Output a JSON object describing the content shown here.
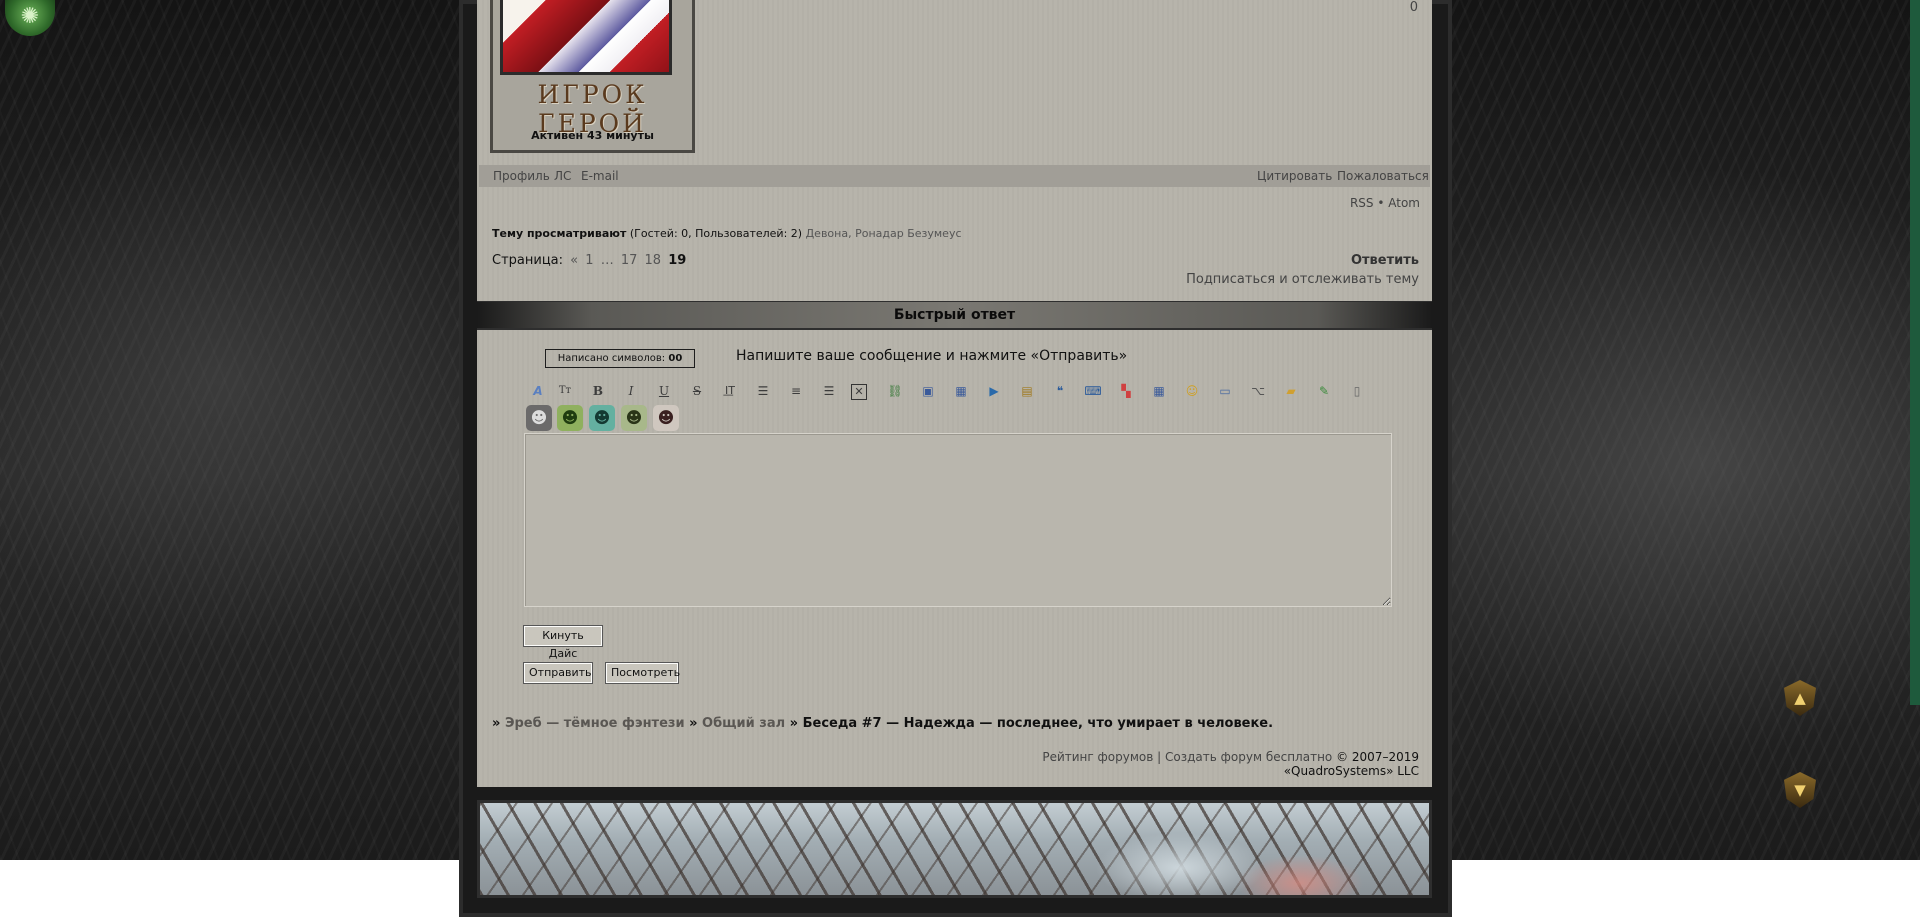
{
  "post": {
    "rank_title": "ИГРОК ГЕРОЙ",
    "active_status": "Активен 43 минуты",
    "counter": "0",
    "links": {
      "profile": "Профиль",
      "pm": "ЛС",
      "email": "E-mail",
      "quote": "Цитировать",
      "report": "Пожаловаться"
    }
  },
  "feeds": {
    "rss": "RSS",
    "separator": "•",
    "atom": "Atom"
  },
  "viewers": {
    "label": "Тему просматривают",
    "counts": "(Гостей: 0, Пользователей: 2)",
    "users": [
      "Девона",
      "Ронадар Безумеус"
    ]
  },
  "pagination": {
    "label": "Страница:",
    "prev": "«",
    "pages": [
      "1",
      "…",
      "17",
      "18"
    ],
    "current": "19"
  },
  "actions": {
    "reply": "Ответить",
    "subscribe": "Подписаться и отслеживать тему"
  },
  "quick_reply": {
    "title": "Быстрый ответ",
    "char_counter_label": "Написано символов:",
    "char_counter_value": "00",
    "hint": "Напишите ваше сообщение и нажмите «Отправить»",
    "toolbar_icons": [
      "font-color-icon",
      "font-size-icon",
      "bold-icon",
      "italic-icon",
      "underline-icon",
      "strikethrough-icon",
      "text-indent-icon",
      "align-left-icon",
      "align-center-icon",
      "align-right-icon",
      "remove-format-icon",
      "link-icon",
      "image-icon",
      "gallery-icon",
      "video-icon",
      "spoiler-icon",
      "quote-icon",
      "code-icon",
      "color-palette-icon",
      "table-icon",
      "smiley-icon",
      "hidden-text-icon",
      "dice-icon",
      "folder-icon",
      "edit-icon",
      "clipboard-icon"
    ],
    "smileys": [
      "robot-smiley",
      "green-creature-smiley",
      "blue-creature-smiley",
      "frog-smiley",
      "character-smiley"
    ],
    "message_value": "",
    "buttons": {
      "dice": "Кинуть Дайс",
      "send": "Отправить",
      "preview": "Посмотреть"
    }
  },
  "breadcrumb": {
    "sep": "»",
    "items": [
      "Эреб — тёмное фэнтези",
      "Общий зал"
    ],
    "current": "Беседа #7 — Надежда — последнее, что умирает в человеке."
  },
  "footer": {
    "rating": "Рейтинг форумов",
    "divider": "|",
    "create": "Создать форум бесплатно",
    "copyright": "© 2007–2019 «QuadroSystems» LLC"
  },
  "colors": {
    "forum_bg": "#b6b3aa",
    "page_bg": "#0b0b0b",
    "accent_green": "#1e5a3c"
  }
}
